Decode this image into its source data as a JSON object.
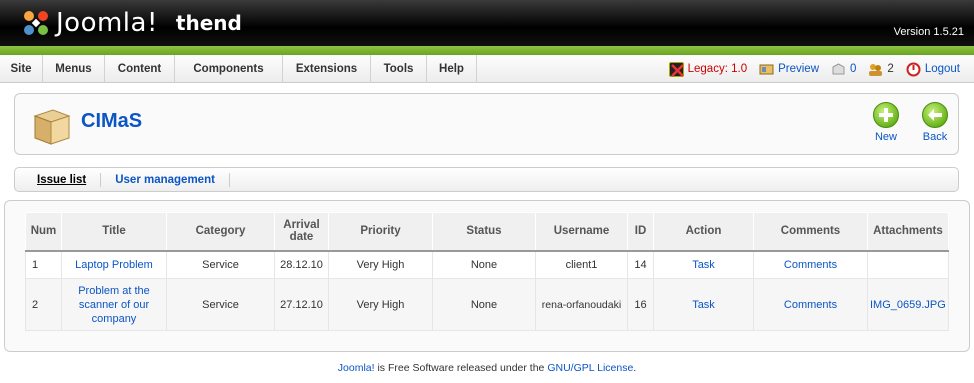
{
  "header": {
    "brand": "Joomla!",
    "site_name": "thend",
    "version": "Version 1.5.21"
  },
  "menu": {
    "items": [
      {
        "label": "Site"
      },
      {
        "label": "Menus"
      },
      {
        "label": "Content"
      },
      {
        "label": "Components"
      },
      {
        "label": "Extensions"
      },
      {
        "label": "Tools"
      },
      {
        "label": "Help"
      }
    ]
  },
  "status": {
    "legacy": "Legacy: 1.0",
    "preview": "Preview",
    "messages": "0",
    "users": "2",
    "logout": "Logout"
  },
  "toolbar": {
    "title": "CIMaS",
    "new_label": "New",
    "back_label": "Back"
  },
  "submenu": {
    "items": [
      {
        "label": "Issue list",
        "active": true
      },
      {
        "label": "User management",
        "active": false
      }
    ]
  },
  "table": {
    "columns": [
      "Num",
      "Title",
      "Category",
      "Arrival date",
      "Priority",
      "Status",
      "Username",
      "ID",
      "Action",
      "Comments",
      "Attachments"
    ],
    "rows": [
      {
        "num": "1",
        "title": "Laptop Problem",
        "category": "Service",
        "date": "28.12.10",
        "priority": "Very High",
        "status": "None",
        "username": "client1",
        "id": "14",
        "action": "Task",
        "comments": "Comments",
        "attachments": ""
      },
      {
        "num": "2",
        "title": "Problem at the scanner of our company",
        "category": "Service",
        "date": "27.12.10",
        "priority": "Very High",
        "status": "None",
        "username": "rena-orfanoudaki",
        "id": "16",
        "action": "Task",
        "comments": "Comments",
        "attachments": "IMG_0659.JPG"
      }
    ]
  },
  "footer": {
    "joomla": "Joomla!",
    "text": " is Free Software released under the ",
    "license": "GNU/GPL License",
    "end": "."
  },
  "colors": {
    "link": "#0b55c4",
    "green": "#7ab62f",
    "legacy": "#cc0000"
  }
}
